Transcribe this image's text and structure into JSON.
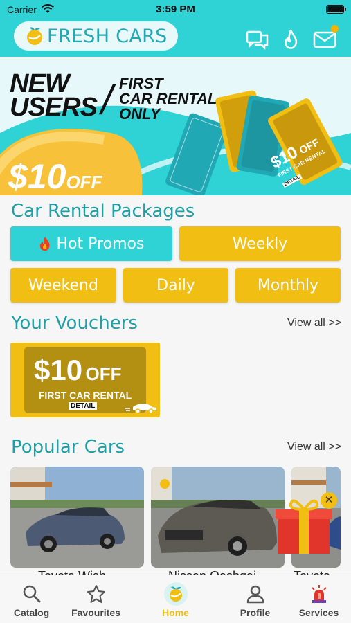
{
  "status_bar": {
    "carrier": "Carrier",
    "time": "3:59 PM"
  },
  "header": {
    "brand": "FRESH CARS",
    "icons": [
      "chat-icon",
      "flame-icon",
      "mail-icon"
    ],
    "colors": {
      "teal": "#2fd3d6",
      "yellow": "#f1be13",
      "brand_text": "#21a8b5"
    }
  },
  "banner": {
    "headline": "NEW USERS",
    "headline_line1": "NEW",
    "headline_line2": "USERS",
    "subhead_line1": "FIRST",
    "subhead_line2": "CAR RENTAL",
    "subhead_line3": "ONLY",
    "amount": "$10",
    "amount_suffix": "OFF",
    "ticket_amount": "$10",
    "ticket_off": "OFF",
    "ticket_sub": "FIRST CAR RENTAL",
    "ticket_detail": "DETAIL"
  },
  "packages": {
    "title": "Car Rental Packages",
    "hot_label": "Hot Promos",
    "weekly_label": "Weekly",
    "weekend_label": "Weekend",
    "daily_label": "Daily",
    "monthly_label": "Monthly"
  },
  "vouchers": {
    "title": "Your Vouchers",
    "view_all": "View all >>",
    "items": [
      {
        "amount": "$10",
        "off": "OFF",
        "subtitle": "FIRST CAR RENTAL",
        "detail": "DETAIL"
      }
    ]
  },
  "popular": {
    "title": "Popular Cars",
    "view_all": "View all >>",
    "cars": [
      {
        "name": "Toyota Wish"
      },
      {
        "name": "Nissan Qashqai"
      },
      {
        "name": "Toyota"
      }
    ]
  },
  "tabs": [
    {
      "label": "Catalog",
      "icon": "search-icon"
    },
    {
      "label": "Favourites",
      "icon": "star-icon"
    },
    {
      "label": "Home",
      "icon": "home-fruit-icon"
    },
    {
      "label": "Profile",
      "icon": "person-icon"
    },
    {
      "label": "Services",
      "icon": "siren-icon"
    }
  ]
}
